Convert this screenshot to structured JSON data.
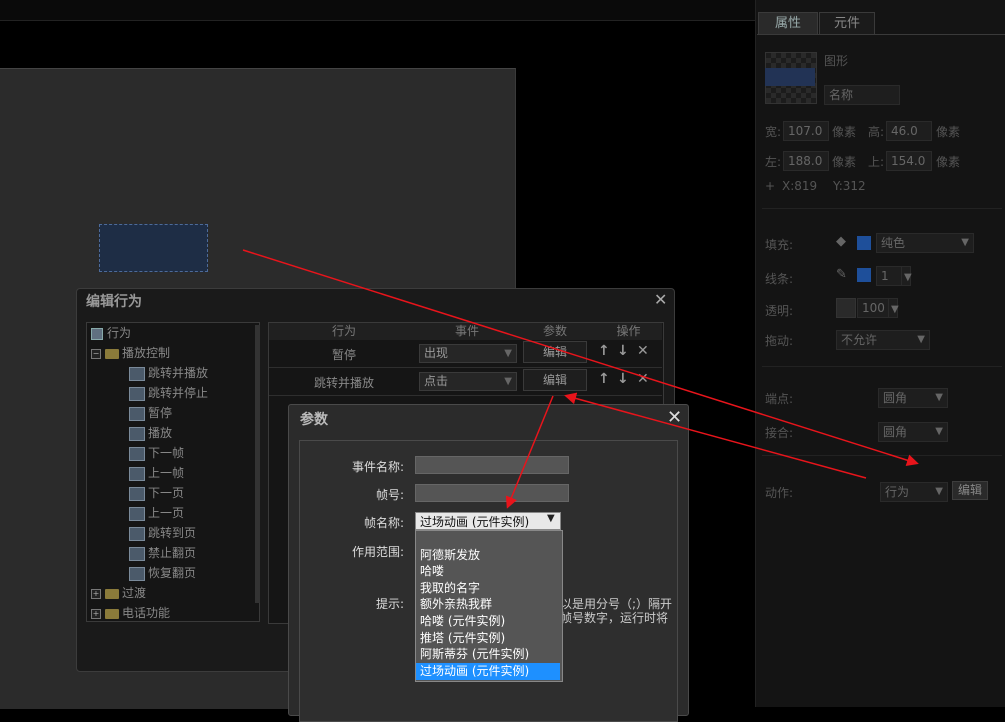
{
  "right_panel": {
    "tabs": [
      "属性",
      "元件"
    ],
    "shape_type": "图形",
    "name_placeholder": "名称",
    "width_label": "宽:",
    "width_value": "107.0",
    "width_unit": "像素",
    "height_label": "高:",
    "height_value": "46.0",
    "height_unit": "像素",
    "left_label": "左:",
    "left_value": "188.0",
    "left_unit": "像素",
    "top_label": "上:",
    "top_value": "154.0",
    "top_unit": "像素",
    "cursor_x": "X:819",
    "cursor_y": "Y:312",
    "fill_label": "填充:",
    "fill_value": "纯色",
    "stroke_label": "线条:",
    "stroke_value": "1",
    "opacity_label": "透明:",
    "opacity_value": "100",
    "drag_label": "拖动:",
    "drag_value": "不允许",
    "endpoint_label": "端点:",
    "endpoint_value": "圆角",
    "join_label": "接合:",
    "join_value": "圆角",
    "action_label": "动作:",
    "action_value": "行为",
    "action_edit": "编辑",
    "accent_color": "#1e4f9a"
  },
  "behavior_dialog": {
    "title": "编辑行为",
    "tree": {
      "root": "行为",
      "group1": "播放控制",
      "items": [
        "跳转并播放",
        "跳转并停止",
        "暂停",
        "播放",
        "下一帧",
        "上一帧",
        "下一页",
        "上一页",
        "跳转到页",
        "禁止翻页",
        "恢复翻页"
      ],
      "group2": "过渡",
      "group3": "电话功能"
    },
    "table": {
      "headers": [
        "行为",
        "事件",
        "参数",
        "操作"
      ],
      "rows": [
        {
          "behavior": "暂停",
          "event": "出现",
          "param": "编辑"
        },
        {
          "behavior": "跳转并播放",
          "event": "点击",
          "param": "编辑"
        }
      ]
    }
  },
  "params_dialog": {
    "title": "参数",
    "event_name_label": "事件名称:",
    "frame_no_label": "帧号:",
    "frame_name_label": "帧名称:",
    "frame_name_value": "过场动画 (元件实例)",
    "scope_label": "作用范围:",
    "hint_label": "提示:",
    "hint_line1": "以是用分号（;）隔开",
    "hint_line2": "帧号数字，运行时将",
    "options": [
      "",
      "阿德斯发放",
      "哈喽",
      "我取的名字",
      "额外亲热我群",
      "哈喽 (元件实例)",
      "推塔 (元件实例)",
      "阿斯蒂芬 (元件实例)",
      "过场动画 (元件实例)"
    ],
    "selected_index": 8,
    "selected_color": "#1e90ff"
  }
}
